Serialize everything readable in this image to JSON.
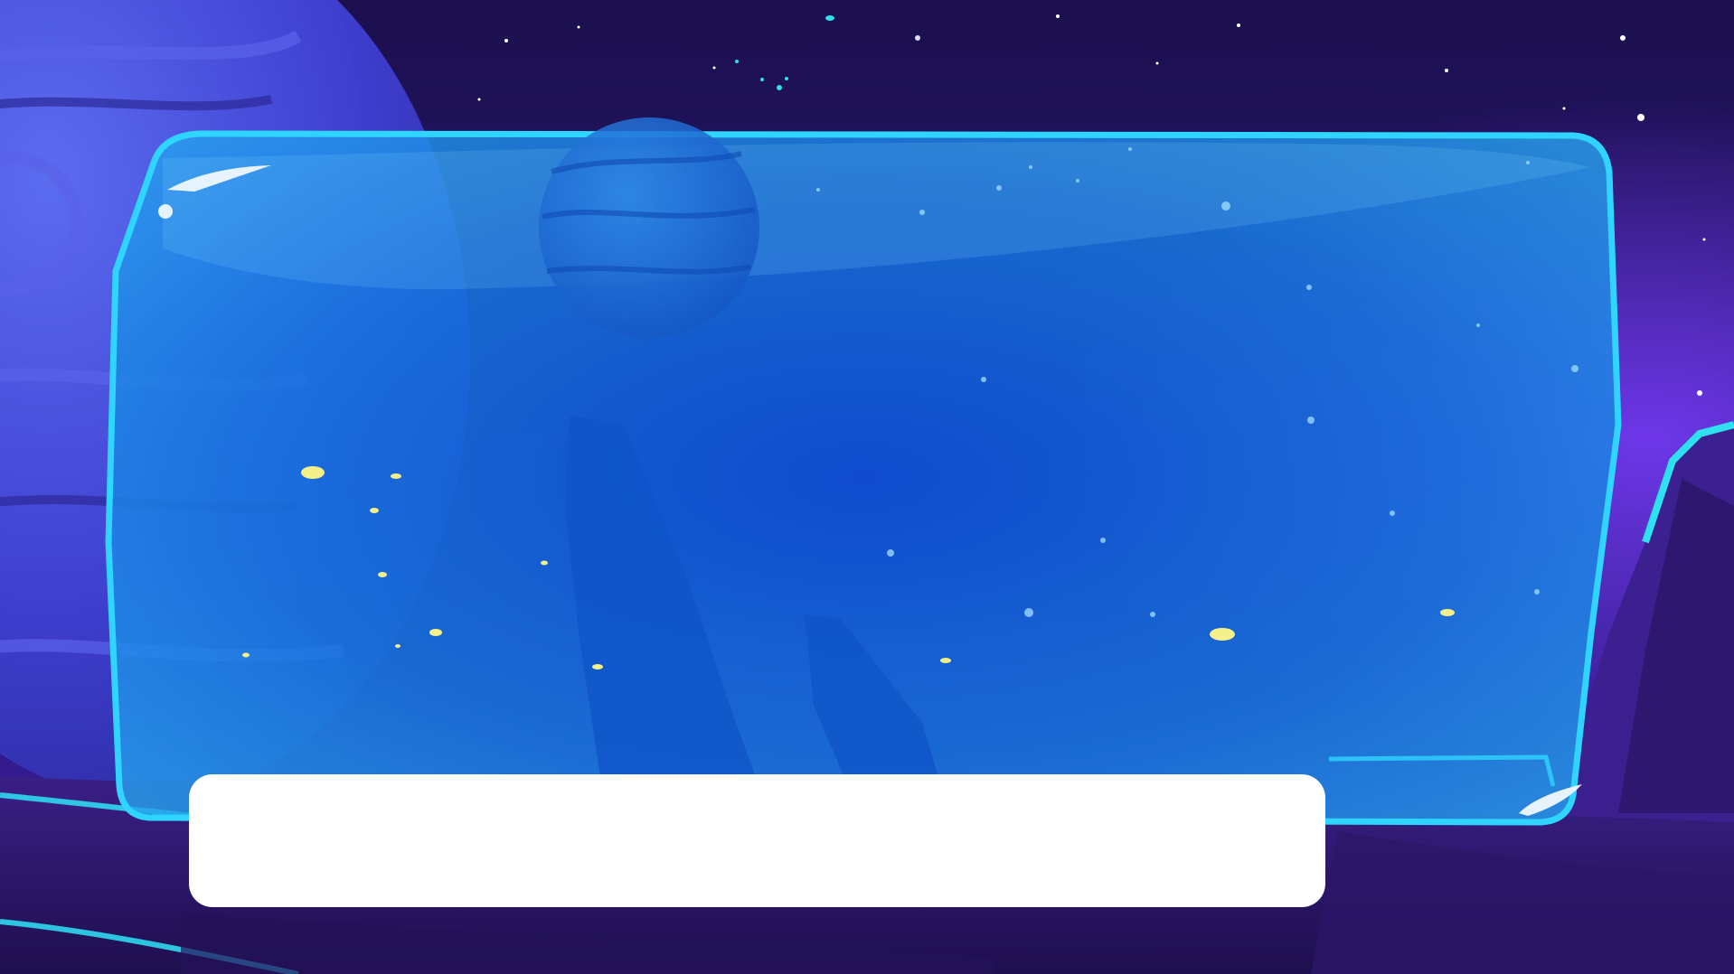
{
  "scene": {
    "name": "space-glass-panel-scene",
    "colors": {
      "sky_top": "#1b0f4e",
      "sky_mid": "#2a1a78",
      "horizon_glow": "#5a2cf0",
      "panel_fill": "#1e8fe8",
      "panel_border": "#2fd4ff",
      "planet": "#3b4fd8",
      "ground": "#2a175f",
      "rock": "#3a1f7a",
      "light_dot": "#f4f08a"
    }
  },
  "dialog": {
    "text": ""
  }
}
